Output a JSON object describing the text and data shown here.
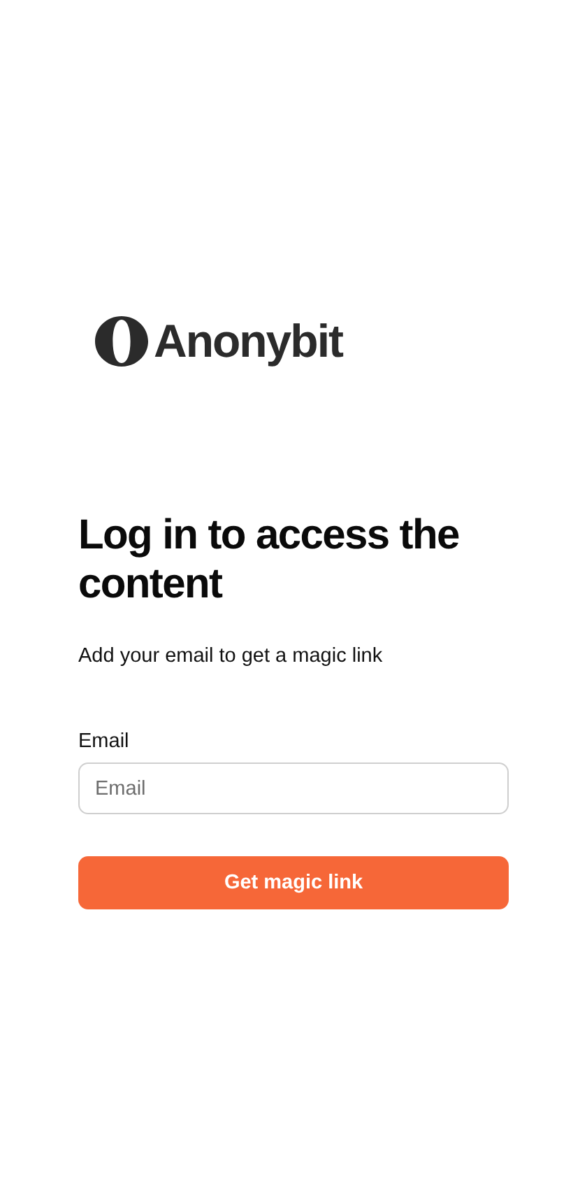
{
  "logo": {
    "name": "Anonybit"
  },
  "heading": "Log in to access the content",
  "subtitle": "Add your email to get a magic link",
  "email_field": {
    "label": "Email",
    "placeholder": "Email"
  },
  "submit_button": "Get magic link"
}
